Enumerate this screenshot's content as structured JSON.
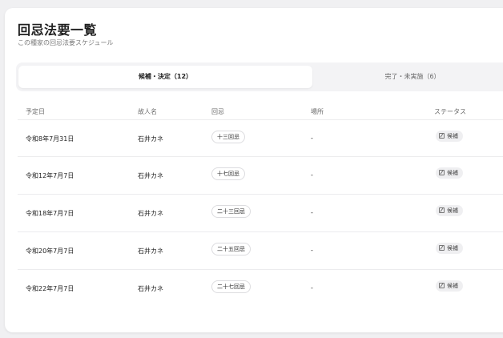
{
  "header": {
    "title": "回忌法要一覧",
    "subtitle": "この種家の回忌法要スケジュール"
  },
  "tabs": [
    {
      "label": "候補・決定（12）",
      "active": true
    },
    {
      "label": "完了・未実施（6）",
      "active": false
    }
  ],
  "table": {
    "columns": [
      "予定日",
      "故人名",
      "回忌",
      "場所",
      "ステータス"
    ],
    "rows": [
      {
        "date": "令和8年7月31日",
        "name": "石井カネ",
        "kaiki": "十三回忌",
        "place": "-",
        "status": "候補"
      },
      {
        "date": "令和12年7月7日",
        "name": "石井カネ",
        "kaiki": "十七回忌",
        "place": "-",
        "status": "候補"
      },
      {
        "date": "令和18年7月7日",
        "name": "石井カネ",
        "kaiki": "二十三回忌",
        "place": "-",
        "status": "候補"
      },
      {
        "date": "令和20年7月7日",
        "name": "石井カネ",
        "kaiki": "二十五回忌",
        "place": "-",
        "status": "候補"
      },
      {
        "date": "令和22年7月7日",
        "name": "石井カネ",
        "kaiki": "二十七回忌",
        "place": "-",
        "status": "候補"
      }
    ]
  },
  "icons": {
    "status_icon": "edit-icon"
  }
}
